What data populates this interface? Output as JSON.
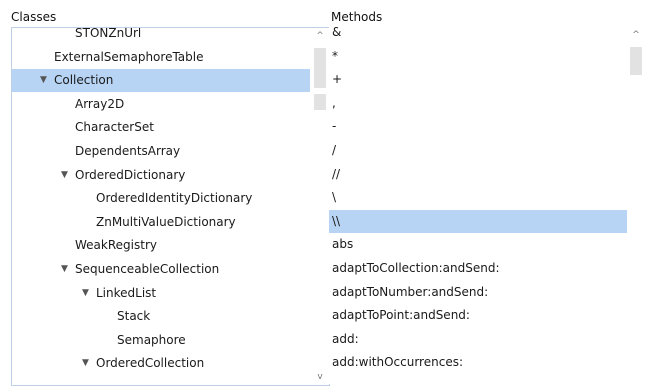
{
  "classes_pane": {
    "title": "Classes",
    "items": [
      {
        "label": "STONZnUrl",
        "expanded": null
      },
      {
        "label": "ExternalSemaphoreTable",
        "expanded": null
      },
      {
        "label": "Collection",
        "expanded": true,
        "selected": true
      },
      {
        "label": "Array2D",
        "expanded": null
      },
      {
        "label": "CharacterSet",
        "expanded": null
      },
      {
        "label": "DependentsArray",
        "expanded": null
      },
      {
        "label": "OrderedDictionary",
        "expanded": true
      },
      {
        "label": "OrderedIdentityDictionary",
        "expanded": null
      },
      {
        "label": "ZnMultiValueDictionary",
        "expanded": null
      },
      {
        "label": "WeakRegistry",
        "expanded": null
      },
      {
        "label": "SequenceableCollection",
        "expanded": true
      },
      {
        "label": "LinkedList",
        "expanded": true
      },
      {
        "label": "Stack",
        "expanded": null
      },
      {
        "label": "Semaphore",
        "expanded": null
      },
      {
        "label": "OrderedCollection",
        "expanded": true
      }
    ],
    "expand_glyph": "▼",
    "scroll_up_glyph": "^",
    "scroll_down_glyph": "v"
  },
  "methods_pane": {
    "title": "Methods",
    "items": [
      {
        "label": "&"
      },
      {
        "label": "*"
      },
      {
        "label": "+"
      },
      {
        "label": ","
      },
      {
        "label": "-"
      },
      {
        "label": "/"
      },
      {
        "label": "//"
      },
      {
        "label": "\\"
      },
      {
        "label": "\\\\",
        "selected": true
      },
      {
        "label": "abs"
      },
      {
        "label": "adaptToCollection:andSend:"
      },
      {
        "label": "adaptToNumber:andSend:"
      },
      {
        "label": "adaptToPoint:andSend:"
      },
      {
        "label": "add:"
      },
      {
        "label": "add:withOccurrences:"
      }
    ],
    "scroll_up_glyph": "^"
  },
  "colors": {
    "selection": "#b8d4f4",
    "scroll_thumb": "#e2e2e2"
  }
}
